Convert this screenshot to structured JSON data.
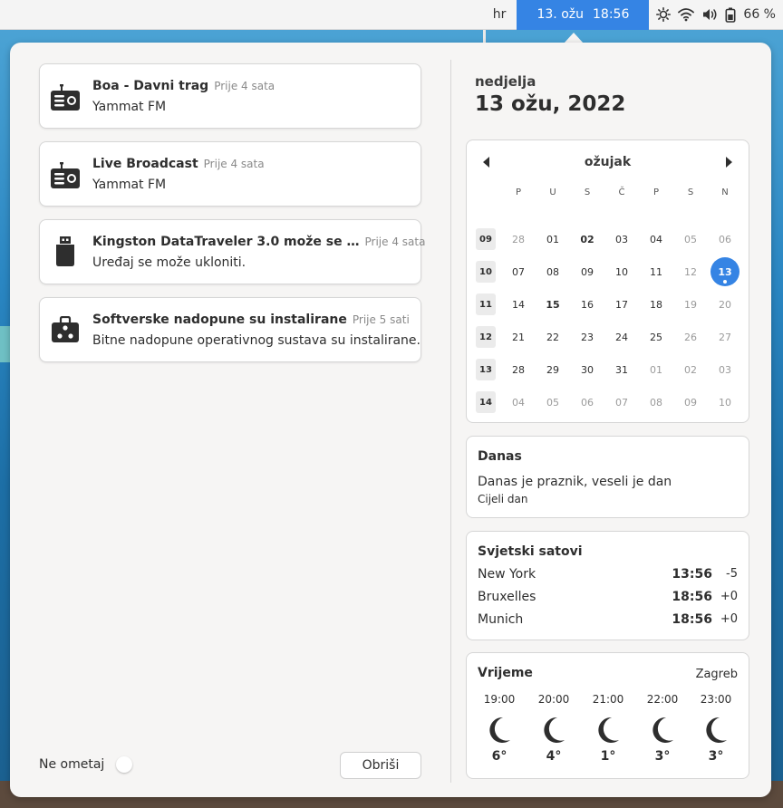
{
  "topbar": {
    "language": "hr",
    "clock_date": "13. ožu",
    "clock_time": "18:56",
    "battery": "66 %"
  },
  "notifications": [
    {
      "title": "Boa - Davni trag",
      "time": "Prije 4 sata",
      "body": "Yammat FM",
      "icon": "radio-icon"
    },
    {
      "title": "Live Broadcast",
      "time": "Prije 4 sata",
      "body": "Yammat FM",
      "icon": "radio-icon"
    },
    {
      "title": "Kingston DataTraveler 3.0 može se …",
      "time": "Prije 4 sata",
      "body": "Uređaj se može ukloniti.",
      "icon": "usb-drive-icon"
    },
    {
      "title": "Softverske nadopune su instalirane",
      "time": "Prije 5 sati",
      "body": "Bitne nadopune operativnog sustava su instalirane.",
      "icon": "software-update-icon"
    }
  ],
  "dnd": {
    "label": "Ne ometaj",
    "enabled": false
  },
  "clear_label": "Obriši",
  "date_header": {
    "weekday": "nedjelja",
    "date": "13 ožu, 2022"
  },
  "calendar": {
    "month": "ožujak",
    "weekdays": [
      "P",
      "U",
      "S",
      "Č",
      "P",
      "S",
      "N"
    ],
    "weeks": [
      {
        "num": "09",
        "days": [
          {
            "d": "28",
            "o": true
          },
          {
            "d": "01"
          },
          {
            "d": "02",
            "b": true
          },
          {
            "d": "03"
          },
          {
            "d": "04"
          },
          {
            "d": "05",
            "o": true
          },
          {
            "d": "06",
            "o": true
          }
        ]
      },
      {
        "num": "10",
        "days": [
          {
            "d": "07"
          },
          {
            "d": "08"
          },
          {
            "d": "09"
          },
          {
            "d": "10"
          },
          {
            "d": "11"
          },
          {
            "d": "12",
            "o": true
          },
          {
            "d": "13",
            "t": true
          }
        ]
      },
      {
        "num": "11",
        "days": [
          {
            "d": "14"
          },
          {
            "d": "15",
            "b": true
          },
          {
            "d": "16"
          },
          {
            "d": "17"
          },
          {
            "d": "18"
          },
          {
            "d": "19",
            "o": true
          },
          {
            "d": "20",
            "o": true
          }
        ]
      },
      {
        "num": "12",
        "days": [
          {
            "d": "21"
          },
          {
            "d": "22"
          },
          {
            "d": "23"
          },
          {
            "d": "24"
          },
          {
            "d": "25"
          },
          {
            "d": "26",
            "o": true
          },
          {
            "d": "27",
            "o": true
          }
        ]
      },
      {
        "num": "13",
        "days": [
          {
            "d": "28"
          },
          {
            "d": "29"
          },
          {
            "d": "30"
          },
          {
            "d": "31"
          },
          {
            "d": "01",
            "o": true
          },
          {
            "d": "02",
            "o": true
          },
          {
            "d": "03",
            "o": true
          }
        ]
      },
      {
        "num": "14",
        "days": [
          {
            "d": "04",
            "o": true
          },
          {
            "d": "05",
            "o": true
          },
          {
            "d": "06",
            "o": true
          },
          {
            "d": "07",
            "o": true
          },
          {
            "d": "08",
            "o": true
          },
          {
            "d": "09",
            "o": true
          },
          {
            "d": "10",
            "o": true
          }
        ]
      }
    ]
  },
  "events": {
    "title": "Danas",
    "event_title": "Danas je praznik, veseli je dan",
    "event_time": "Cijeli dan"
  },
  "world_clocks": {
    "title": "Svjetski satovi",
    "clocks": [
      {
        "city": "New York",
        "time": "13:56",
        "offset": "-5"
      },
      {
        "city": "Bruxelles",
        "time": "18:56",
        "offset": "+0"
      },
      {
        "city": "Munich",
        "time": "18:56",
        "offset": "+0"
      }
    ]
  },
  "weather": {
    "title": "Vrijeme",
    "location": "Zagreb",
    "forecast": [
      {
        "time": "19:00",
        "temp": "6°",
        "icon": "moon-icon"
      },
      {
        "time": "20:00",
        "temp": "4°",
        "icon": "moon-icon"
      },
      {
        "time": "21:00",
        "temp": "1°",
        "icon": "moon-icon"
      },
      {
        "time": "22:00",
        "temp": "3°",
        "icon": "moon-icon"
      },
      {
        "time": "23:00",
        "temp": "3°",
        "icon": "moon-icon"
      }
    ]
  },
  "colors": {
    "accent": "#3584e4"
  }
}
